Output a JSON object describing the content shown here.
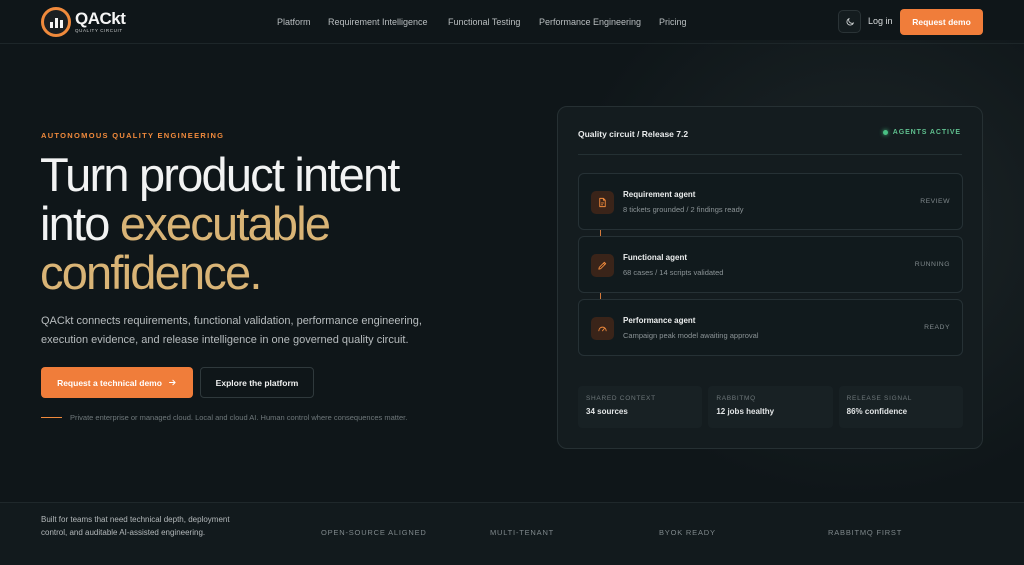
{
  "brand": {
    "name_part1": "QA",
    "name_part2": "Ckt",
    "tagline": "QUALITY CIRCUIT",
    "accent_color": "#f07d3a"
  },
  "nav": {
    "items": [
      "Platform",
      "Requirement Intelligence",
      "Functional Testing",
      "Performance Engineering",
      "Pricing"
    ],
    "theme_icon": "moon-icon",
    "login_label": "Log in",
    "demo_label": "Request demo"
  },
  "hero": {
    "eyebrow": "AUTONOMOUS QUALITY ENGINEERING",
    "headline_line1": "Turn product intent",
    "headline_into": "into",
    "headline_accent1": "executable",
    "headline_accent2": "confidence.",
    "subcopy": "QACkt connects requirements, functional validation, performance engineering, execution evidence, and release intelligence in one governed quality circuit.",
    "primary_cta": "Request a technical demo",
    "primary_cta_icon": "arrow-right-icon",
    "secondary_cta": "Explore the platform",
    "deployment_note": "Private enterprise or managed cloud. Local and cloud AI. Human control where consequences matter."
  },
  "panel": {
    "title": "Quality circuit / Release 7.2",
    "status": "AGENTS ACTIVE",
    "status_color": "#49c184",
    "agents": [
      {
        "name": "Requirement agent",
        "detail": "8 tickets grounded / 2 findings ready",
        "status": "REVIEW",
        "icon": "document-icon"
      },
      {
        "name": "Functional agent",
        "detail": "68 cases / 14 scripts validated",
        "status": "RUNNING",
        "icon": "pencil-icon"
      },
      {
        "name": "Performance agent",
        "detail": "Campaign peak model awaiting approval",
        "status": "READY",
        "icon": "gauge-icon"
      }
    ],
    "stats": [
      {
        "label": "SHARED CONTEXT",
        "value": "34 sources"
      },
      {
        "label": "RABBITMQ",
        "value": "12 jobs healthy"
      },
      {
        "label": "RELEASE SIGNAL",
        "value": "86% confidence"
      }
    ]
  },
  "footer": {
    "text": "Built for teams that need technical depth, deployment control, and auditable AI-assisted engineering.",
    "badges": [
      "OPEN-SOURCE ALIGNED",
      "MULTI-TENANT",
      "BYOK READY",
      "RABBITMQ FIRST"
    ]
  }
}
